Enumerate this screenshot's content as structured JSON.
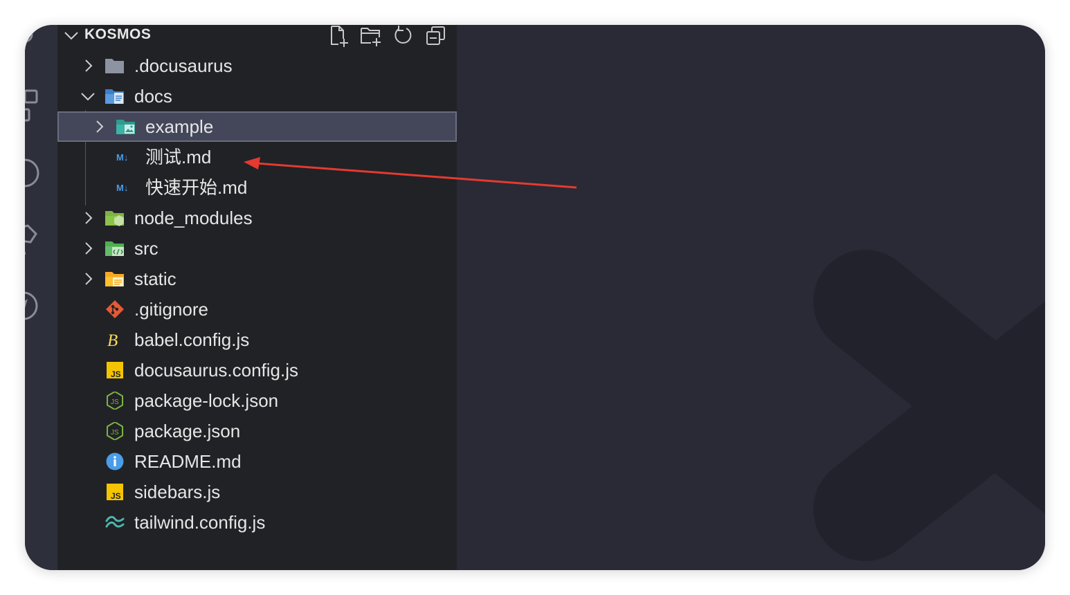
{
  "explorer": {
    "title": "KOSMOS",
    "toolbar": {
      "new_file_icon": "new-file-icon",
      "new_folder_icon": "new-folder-icon",
      "refresh_icon": "refresh-icon",
      "collapse_icon": "collapse-all-icon"
    },
    "items": [
      {
        "label": ".docusaurus",
        "type": "folder",
        "expanded": false,
        "icon": "folder-icon"
      },
      {
        "label": "docs",
        "type": "folder",
        "expanded": true,
        "icon": "docs-folder-icon"
      },
      {
        "label": "example",
        "type": "folder",
        "expanded": false,
        "icon": "images-folder-icon",
        "selected": true
      },
      {
        "label": "测试.md",
        "type": "file",
        "icon": "markdown-icon",
        "icon_text": "M↓"
      },
      {
        "label": "快速开始.md",
        "type": "file",
        "icon": "markdown-icon",
        "icon_text": "M↓"
      },
      {
        "label": "node_modules",
        "type": "folder",
        "expanded": false,
        "icon": "node-folder-icon"
      },
      {
        "label": "src",
        "type": "folder",
        "expanded": false,
        "icon": "src-folder-icon"
      },
      {
        "label": "static",
        "type": "folder",
        "expanded": false,
        "icon": "static-folder-icon"
      },
      {
        "label": ".gitignore",
        "type": "file",
        "icon": "git-icon"
      },
      {
        "label": "babel.config.js",
        "type": "file",
        "icon": "babel-icon",
        "icon_text": "B"
      },
      {
        "label": "docusaurus.config.js",
        "type": "file",
        "icon": "js-icon",
        "icon_text": "JS"
      },
      {
        "label": "package-lock.json",
        "type": "file",
        "icon": "nodejs-icon",
        "icon_text": "JS"
      },
      {
        "label": "package.json",
        "type": "file",
        "icon": "nodejs-icon",
        "icon_text": "JS"
      },
      {
        "label": "README.md",
        "type": "file",
        "icon": "info-icon",
        "icon_text": "i"
      },
      {
        "label": "sidebars.js",
        "type": "file",
        "icon": "js-icon",
        "icon_text": "JS"
      },
      {
        "label": "tailwind.config.js",
        "type": "file",
        "icon": "tailwind-icon"
      }
    ]
  },
  "colors": {
    "sidebar_bg": "#212226",
    "editor_bg": "#292a35",
    "activity_bg": "#2d2f3b",
    "selection_bg": "#44475a",
    "text": "#e6e6e6",
    "annotation_arrow": "#e53a2f"
  }
}
